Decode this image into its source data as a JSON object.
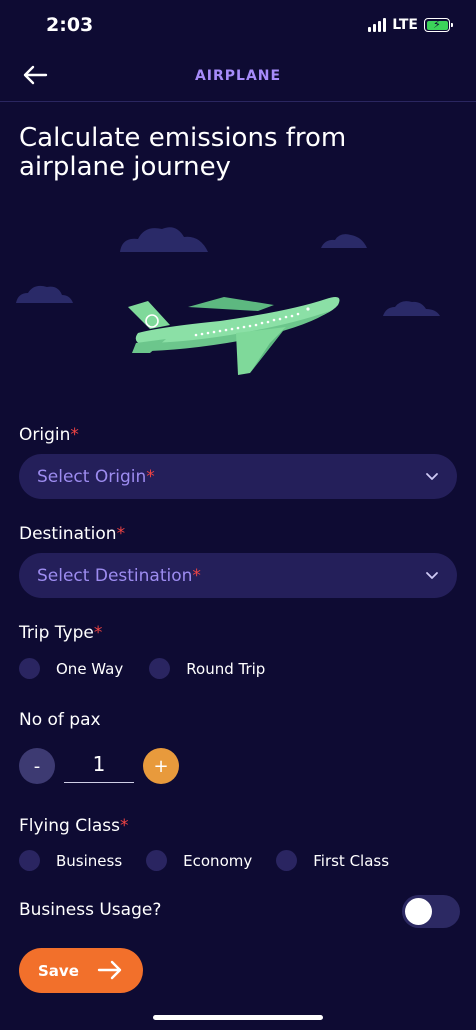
{
  "status_bar": {
    "time": "2:03",
    "network": "LTE"
  },
  "header": {
    "title": "AIRPLANE",
    "back_icon": "arrow-left-icon"
  },
  "page": {
    "title": "Calculate emissions from airplane journey"
  },
  "form": {
    "origin": {
      "label": "Origin",
      "required_mark": "*",
      "placeholder": "Select Origin",
      "placeholder_mark": "*"
    },
    "destination": {
      "label": "Destination",
      "required_mark": "*",
      "placeholder": "Select Destination",
      "placeholder_mark": "*"
    },
    "trip_type": {
      "label": "Trip Type",
      "required_mark": "*",
      "options": [
        "One Way",
        "Round Trip"
      ]
    },
    "pax": {
      "label": "No of pax",
      "minus": "-",
      "value": "1",
      "plus": "+"
    },
    "flying_class": {
      "label": "Flying Class",
      "required_mark": "*",
      "options": [
        "Business",
        "Economy",
        "First Class"
      ]
    },
    "business_usage": {
      "label": "Business Usage?",
      "enabled": false
    },
    "save": {
      "label": "Save"
    }
  },
  "colors": {
    "background": "#0e0b33",
    "accent_purple": "#a78bfa",
    "field_bg": "#241f5a",
    "orange": "#f2702b",
    "plus_orange": "#e89a3c",
    "required": "#ef4444",
    "plane_green": "#7fd99a"
  }
}
